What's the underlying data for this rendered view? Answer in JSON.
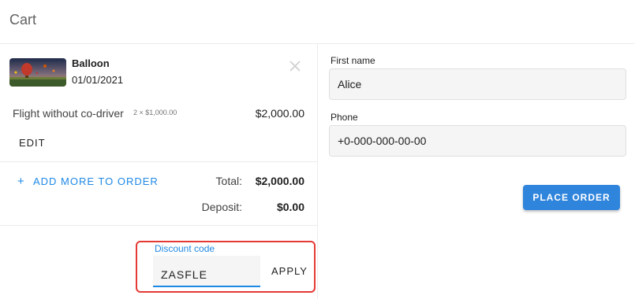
{
  "header": {
    "title": "Cart"
  },
  "cart": {
    "item": {
      "name": "Balloon",
      "date": "01/01/2021",
      "image_icon": "hot-air-balloon-photo",
      "remove_icon": "close-icon"
    },
    "line": {
      "name": "Flight without co-driver",
      "qty_detail": "2 × $1,000.00",
      "price": "$2,000.00"
    },
    "edit_label": "EDIT",
    "add_more_icon": "plus-icon",
    "add_more_label": "ADD MORE TO ORDER",
    "totals": {
      "total_label": "Total:",
      "total_value": "$2,000.00",
      "deposit_label": "Deposit:",
      "deposit_value": "$0.00"
    },
    "discount": {
      "label": "Discount code",
      "value": "ZASFLE",
      "apply_label": "APPLY"
    }
  },
  "form": {
    "first_name": {
      "label": "First name",
      "value": "Alice"
    },
    "phone": {
      "label": "Phone",
      "value": "+0-000-000-00-00"
    },
    "place_order_label": "PLACE ORDER"
  },
  "colors": {
    "accent": "#1e88e5",
    "button": "#2f84dc",
    "highlight_border": "#e53935"
  }
}
